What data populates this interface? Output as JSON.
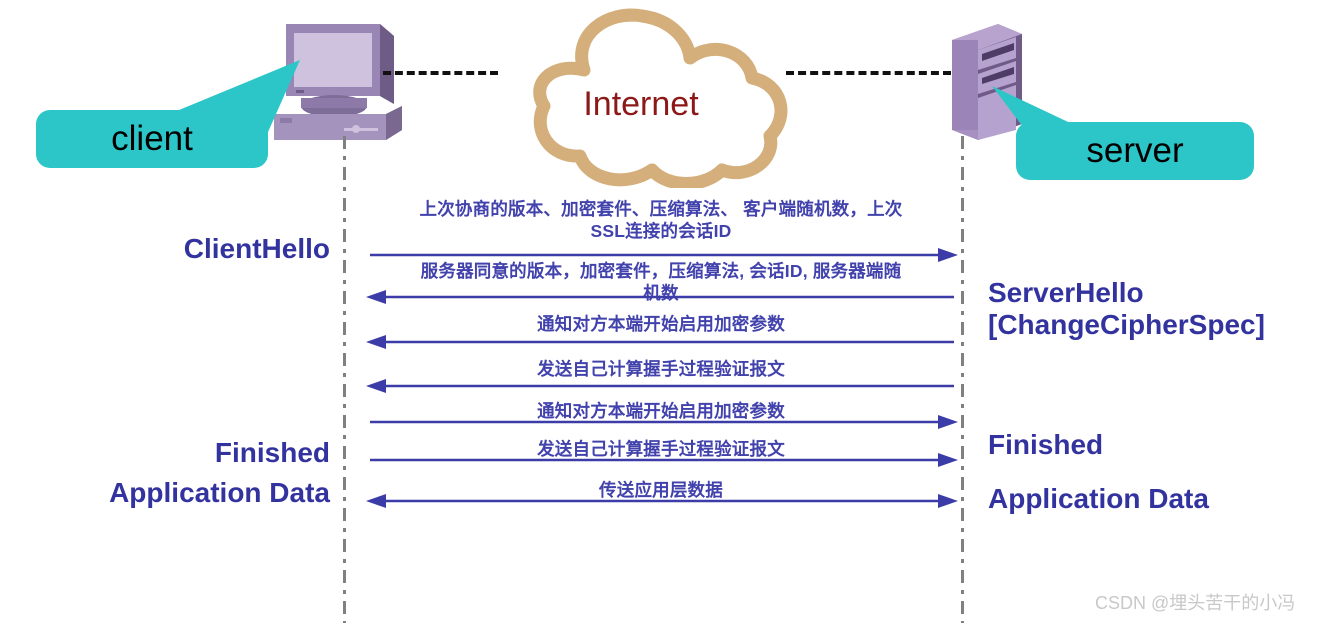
{
  "diagram": {
    "title": "SSL/TLS session resumption handshake sequence diagram",
    "colors": {
      "callout_fill": "#2CC5C8",
      "cloud_stroke": "#D4AF7C",
      "cloud_label": "#8C1818",
      "lifeline": "#808080",
      "message_text": "#4242AD",
      "arrow": "#3C3CA8",
      "side_label": "#3333A0",
      "watermark": "#C8C8C8",
      "netlink": "#111111"
    }
  },
  "actors": {
    "client": {
      "callout_label": "client",
      "icon": "desktop-computer-icon"
    },
    "server": {
      "callout_label": "server",
      "icon": "server-tower-icon"
    }
  },
  "cloud": {
    "label": "Internet",
    "icon": "cloud-icon"
  },
  "side_labels": {
    "left": [
      {
        "text": "ClientHello"
      },
      {
        "text": "Finished"
      },
      {
        "text": "Application Data"
      }
    ],
    "right": [
      {
        "text": "ServerHello"
      },
      {
        "text": "[ChangeCipherSpec]"
      },
      {
        "text": "Finished"
      },
      {
        "text": "Application Data"
      }
    ]
  },
  "messages": [
    {
      "id": "m1",
      "text": "上次协商的版本、加密套件、压缩算法、 客户端随机数，上次\nSSL连接的会话ID",
      "direction": "right"
    },
    {
      "id": "m2",
      "text": "服务器同意的版本，加密套件，压缩算法, 会话ID, 服务器端随\n机数",
      "direction": "left"
    },
    {
      "id": "m3",
      "text": "通知对方本端开始启用加密参数",
      "direction": "left"
    },
    {
      "id": "m4",
      "text": "发送自己计算握手过程验证报文",
      "direction": "left"
    },
    {
      "id": "m5",
      "text": "通知对方本端开始启用加密参数",
      "direction": "right"
    },
    {
      "id": "m6",
      "text": "发送自己计算握手过程验证报文",
      "direction": "right"
    },
    {
      "id": "m7",
      "text": "传送应用层数据",
      "direction": "both"
    }
  ],
  "watermark": {
    "text": "CSDN @埋头苦干的小冯"
  }
}
